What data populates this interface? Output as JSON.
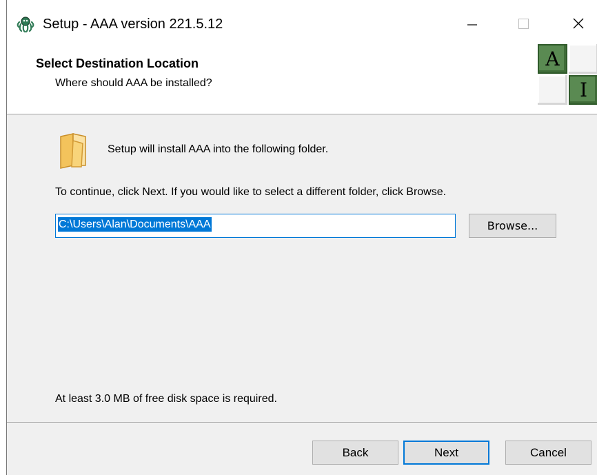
{
  "window": {
    "title": "Setup - AAA version 221.5.12",
    "controls": {
      "minimize": "—",
      "maximize": "☐",
      "close": "✕"
    }
  },
  "header": {
    "title": "Select Destination Location",
    "subtitle": "Where should AAA be installed?",
    "logo_letters": [
      "A",
      "I"
    ]
  },
  "content": {
    "intro": "Setup will install AAA into the following folder.",
    "instruction": "To continue, click Next. If you would like to select a different folder, click Browse.",
    "path_value": "C:\\Users\\Alan\\Documents\\AAA",
    "browse_label": "Browse...",
    "disk_space": "At least 3.0 MB of free disk space is required."
  },
  "footer": {
    "back_label": "Back",
    "next_label": "Next",
    "cancel_label": "Cancel"
  },
  "colors": {
    "accent": "#0078d7",
    "logo_green": "#5a8a52",
    "folder_fill": "#f8d47a"
  }
}
